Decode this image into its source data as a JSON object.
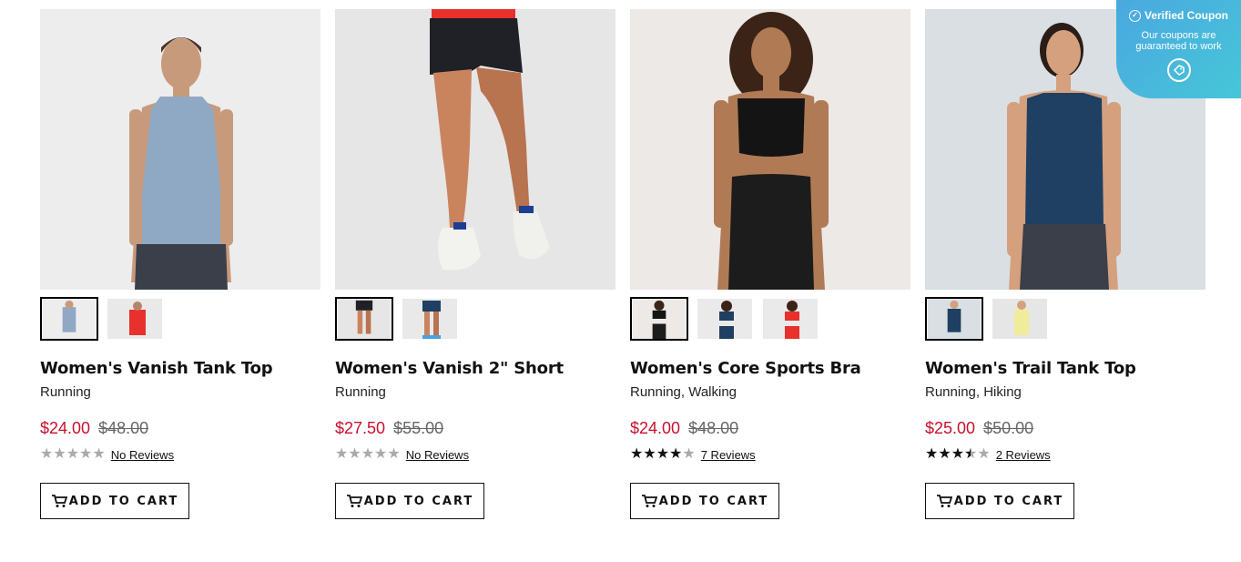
{
  "products": [
    {
      "title": "Women's Vanish Tank Top",
      "categories": "Running",
      "price_sale": "$24.00",
      "price_original": "$48.00",
      "rating_stars": 0,
      "reviews_label": "No Reviews",
      "cart_label": "ADD TO CART",
      "thumb_count": 2
    },
    {
      "title": "Women's Vanish 2\" Short",
      "categories": "Running",
      "price_sale": "$27.50",
      "price_original": "$55.00",
      "rating_stars": 0,
      "reviews_label": "No Reviews",
      "cart_label": "ADD TO CART",
      "thumb_count": 2
    },
    {
      "title": "Women's Core Sports Bra",
      "categories": "Running, Walking",
      "price_sale": "$24.00",
      "price_original": "$48.00",
      "rating_stars": 4,
      "reviews_label": "7 Reviews",
      "cart_label": "ADD TO CART",
      "thumb_count": 3
    },
    {
      "title": "Women's Trail Tank Top",
      "categories": "Running, Hiking",
      "price_sale": "$25.00",
      "price_original": "$50.00",
      "rating_stars": 3.5,
      "reviews_label": "2 Reviews",
      "cart_label": "ADD TO CART",
      "thumb_count": 2
    }
  ],
  "coupon": {
    "title": "Verified Coupon",
    "subtitle": "Our coupons are guaranteed to work",
    "icon": "coupon-tag-icon"
  },
  "colors": {
    "sale_price": "#c8102e",
    "coupon_bg": "#4aa8e0",
    "tank_blue": "#8fa8c4",
    "tank_navy": "#1f3f63",
    "red": "#e8302c"
  }
}
